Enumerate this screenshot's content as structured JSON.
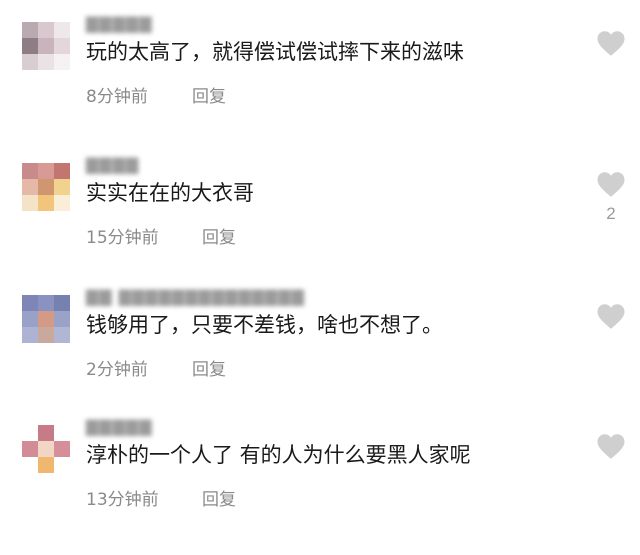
{
  "colors": {
    "heart": "#cfcfcf",
    "meta_text": "#8a8a8a",
    "body_text": "#1a1a1a"
  },
  "icons": {
    "like": "heart-icon"
  },
  "comments": [
    {
      "text": "玩的太高了，就得偿试偿试摔下来的滋味",
      "time": "8分钟前",
      "reply": "回复",
      "likes": ""
    },
    {
      "text": "实实在在的大衣哥",
      "time": "15分钟前",
      "reply": "回复",
      "likes": "2"
    },
    {
      "text": "钱够用了，只要不差钱，啥也不想了。",
      "time": "2分钟前",
      "reply": "回复",
      "likes": ""
    },
    {
      "text": "淳朴的一个人了 有的人为什么要黑人家呢",
      "time": "13分钟前",
      "reply": "回复",
      "likes": ""
    }
  ]
}
